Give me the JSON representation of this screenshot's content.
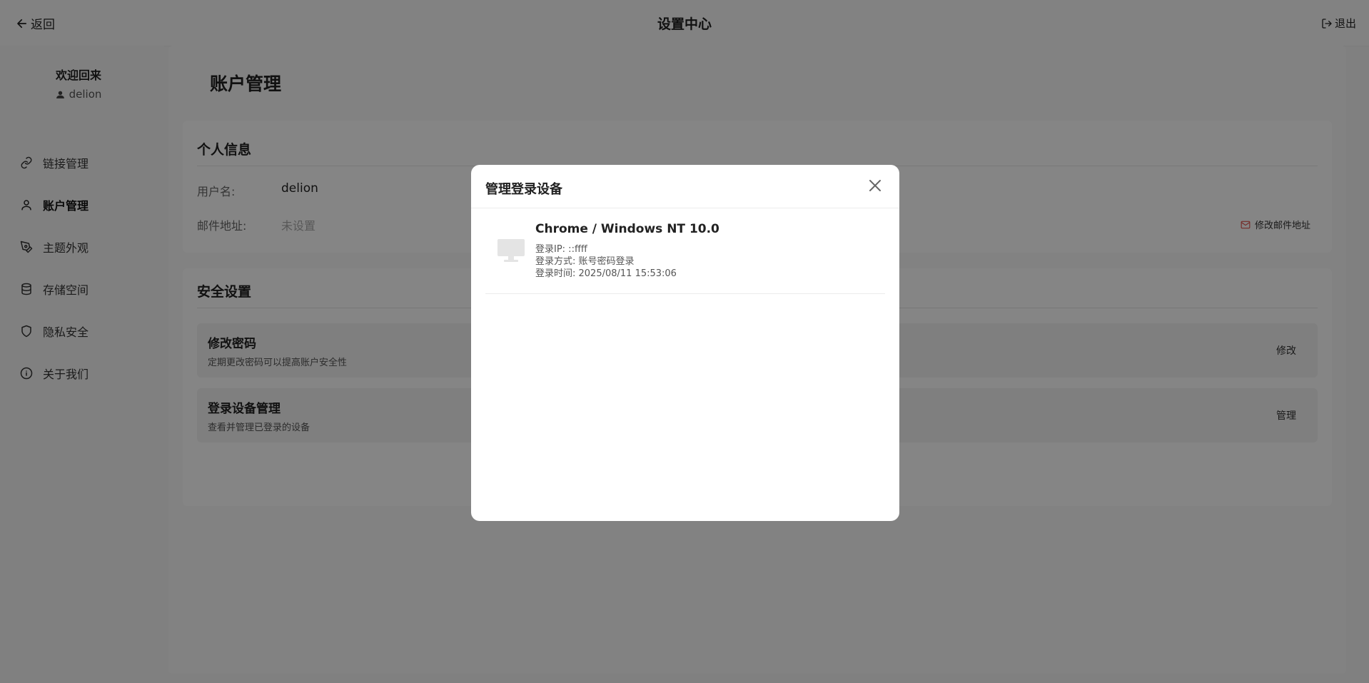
{
  "topbar": {
    "back_label": "返回",
    "title": "设置中心",
    "logout_label": "退出"
  },
  "sidebar": {
    "welcome": "欢迎回来",
    "username": "delion",
    "items": [
      {
        "label": "链接管理",
        "icon": "link-icon"
      },
      {
        "label": "账户管理",
        "icon": "user-icon",
        "active": true
      },
      {
        "label": "主题外观",
        "icon": "pen-icon"
      },
      {
        "label": "存储空间",
        "icon": "database-icon"
      },
      {
        "label": "隐私安全",
        "icon": "shield-icon"
      },
      {
        "label": "关于我们",
        "icon": "info-icon"
      }
    ]
  },
  "main": {
    "page_title": "账户管理",
    "personal": {
      "title": "个人信息",
      "username_label": "用户名:",
      "username_value": "delion",
      "email_label": "邮件地址:",
      "email_value": "未设置",
      "edit_email_label": "修改邮件地址"
    },
    "security": {
      "title": "安全设置",
      "items": [
        {
          "title": "修改密码",
          "desc": "定期更改密码可以提高账户安全性",
          "action": "修改"
        },
        {
          "title": "登录设备管理",
          "desc": "查看并管理已登录的设备",
          "action": "管理"
        }
      ]
    }
  },
  "modal": {
    "title": "管理登录设备",
    "devices": [
      {
        "name": "Chrome / Windows NT 10.0",
        "ip": "登录IP: ::ffff",
        "method": "登录方式: 账号密码登录",
        "time": "登录时间: 2025/08/11 15:53:06"
      }
    ]
  },
  "colors": {
    "overlay": "#000000",
    "email_icon": "#e0554f",
    "background": "#f5f5f5"
  }
}
